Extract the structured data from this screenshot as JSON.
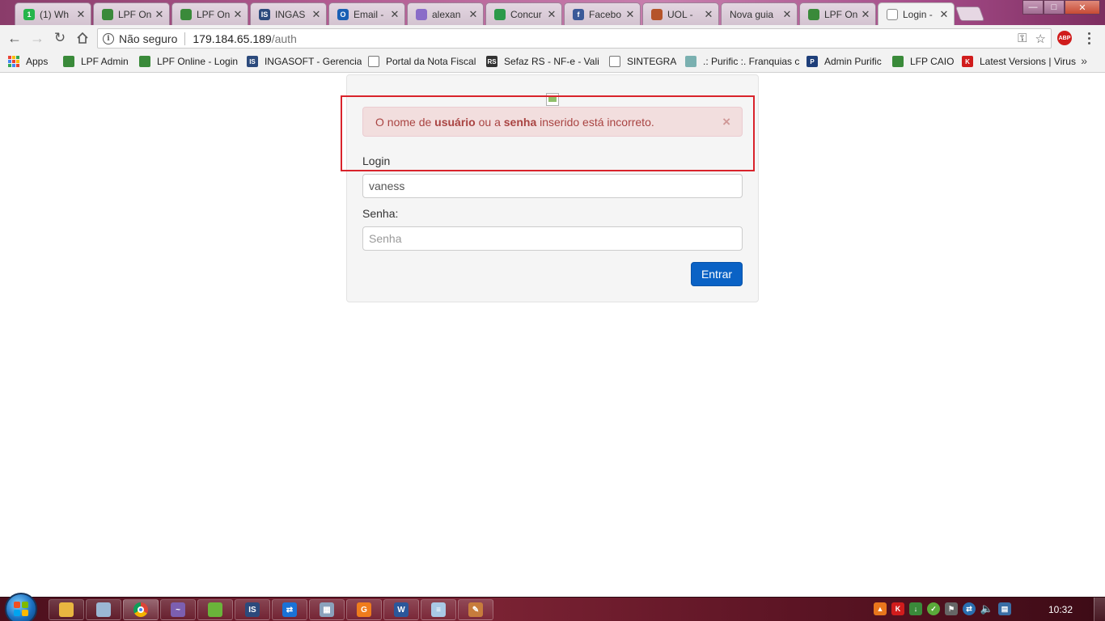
{
  "browser": {
    "tabs": [
      {
        "title": "(1) Wh",
        "icon": "whatsapp-icon",
        "color": "#25b54b",
        "glyph": "1"
      },
      {
        "title": "LPF On",
        "icon": "lpf-icon",
        "color": "#3a8a3a",
        "glyph": ""
      },
      {
        "title": "LPF On",
        "icon": "lpf-icon",
        "color": "#3a8a3a",
        "glyph": ""
      },
      {
        "title": "INGAS",
        "icon": "ingasoft-icon",
        "color": "#2c4a7c",
        "glyph": "IS"
      },
      {
        "title": "Email -",
        "icon": "outlook-icon",
        "color": "#1a5fb4",
        "glyph": "O"
      },
      {
        "title": "alexan",
        "icon": "mail-icon",
        "color": "#8a6cc8",
        "glyph": ""
      },
      {
        "title": "Concur",
        "icon": "google-drive-icon",
        "color": "#2c9a4a",
        "glyph": ""
      },
      {
        "title": "Facebo",
        "icon": "facebook-icon",
        "color": "#3b5998",
        "glyph": "f"
      },
      {
        "title": "UOL - ",
        "icon": "uol-icon",
        "color": "#b5542a",
        "glyph": ""
      },
      {
        "title": "Nova guia",
        "icon": "",
        "color": "",
        "glyph": ""
      },
      {
        "title": "LPF On",
        "icon": "lpf-icon",
        "color": "#3a8a3a",
        "glyph": ""
      },
      {
        "title": "Login -",
        "icon": "page-icon",
        "color": "#ffffff",
        "glyph": "",
        "active": true
      }
    ],
    "address": {
      "security_label": "Não seguro",
      "host": "179.184.65.189",
      "path": "/auth"
    },
    "bookmarks": [
      {
        "label": "Apps",
        "icon": "apps-grid-icon"
      },
      {
        "label": "LPF Admin",
        "icon": "lpf-icon",
        "color": "#3a8a3a",
        "glyph": ""
      },
      {
        "label": "LPF Online - Login",
        "icon": "lpf-icon",
        "color": "#3a8a3a",
        "glyph": ""
      },
      {
        "label": "INGASOFT - Gerencia",
        "icon": "ingasoft-icon",
        "color": "#2c4a7c",
        "glyph": "IS"
      },
      {
        "label": "Portal da Nota Fiscal",
        "icon": "page-icon",
        "color": "#ffffff",
        "glyph": ""
      },
      {
        "label": "Sefaz RS - NF-e - Vali",
        "icon": "sefaz-icon",
        "color": "#333333",
        "glyph": "RS"
      },
      {
        "label": "SINTEGRA",
        "icon": "page-icon",
        "color": "#ffffff",
        "glyph": ""
      },
      {
        "label": ".: Purific :. Franquias c",
        "icon": "purific-icon",
        "color": "#7ab0b0",
        "glyph": ""
      },
      {
        "label": "Admin Purific",
        "icon": "admin-purific-icon",
        "color": "#1e3f7a",
        "glyph": "P"
      },
      {
        "label": "LFP CAIO",
        "icon": "lpf-icon",
        "color": "#3a8a3a",
        "glyph": ""
      },
      {
        "label": "Latest Versions | Virus",
        "icon": "kaspersky-icon",
        "color": "#d01c1c",
        "glyph": "K"
      }
    ]
  },
  "login": {
    "alert": {
      "part1": "O nome de ",
      "bold1": "usuário",
      "part2": " ou a ",
      "bold2": "senha",
      "part3": " inserido está incorreto.",
      "close": "×"
    },
    "login_label": "Login",
    "login_value": "vaness",
    "password_label": "Senha:",
    "password_placeholder": "Senha",
    "submit_label": "Entrar"
  },
  "taskbar": {
    "apps": [
      {
        "name": "explorer-icon",
        "color": "#e8b640",
        "glyph": ""
      },
      {
        "name": "network-icon",
        "color": "#9bb7d4",
        "glyph": ""
      },
      {
        "name": "chrome-icon",
        "color": "#3d9a48",
        "glyph": "",
        "active": true
      },
      {
        "name": "app-swirl-icon",
        "color": "#7c5fb0",
        "glyph": "~"
      },
      {
        "name": "app-green-icon",
        "color": "#6ab43a",
        "glyph": ""
      },
      {
        "name": "ingasoft-icon",
        "color": "#2c4a7c",
        "glyph": "IS"
      },
      {
        "name": "teamviewer-icon",
        "color": "#1a72d6",
        "glyph": "⇄"
      },
      {
        "name": "calculator-icon",
        "color": "#8aa2bc",
        "glyph": "▦"
      },
      {
        "name": "g-app-icon",
        "color": "#ef7c1c",
        "glyph": "G"
      },
      {
        "name": "word-icon",
        "color": "#2b579a",
        "glyph": "W"
      },
      {
        "name": "notepad-icon",
        "color": "#a9c9e6",
        "glyph": "≡"
      },
      {
        "name": "paint-icon",
        "color": "#c77c3c",
        "glyph": "✎"
      }
    ],
    "clock": "10:32"
  }
}
